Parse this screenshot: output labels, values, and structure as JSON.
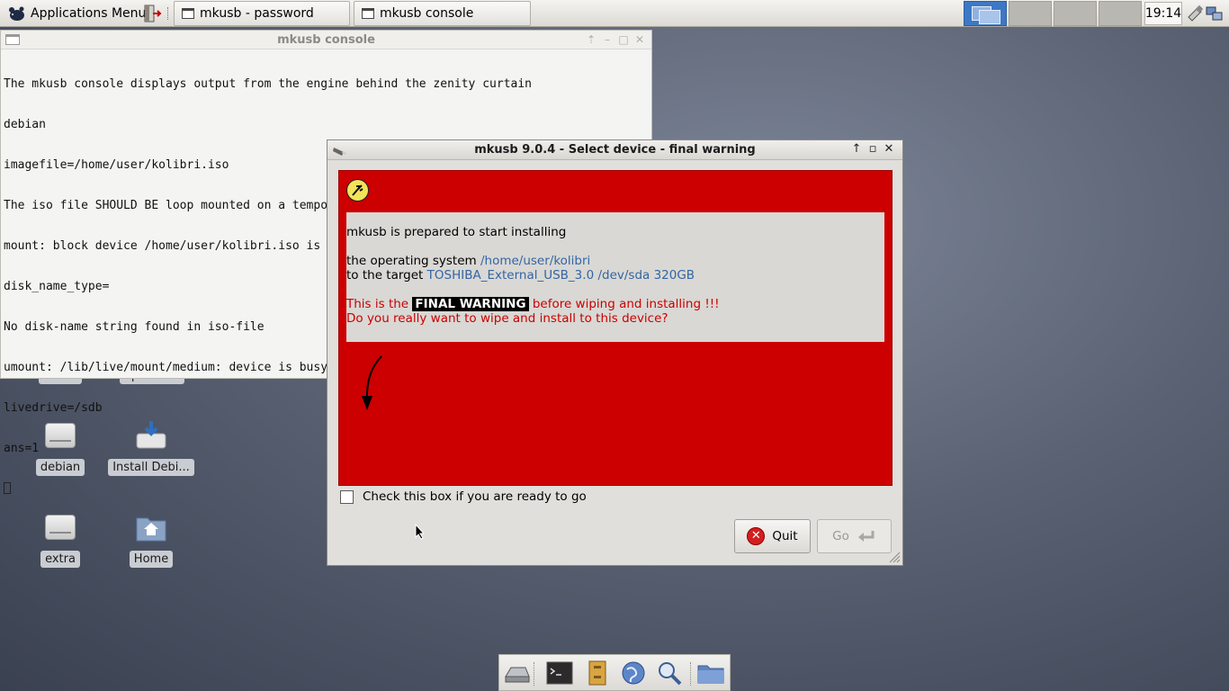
{
  "top_panel": {
    "app_menu_label": "Applications Menu",
    "tasks": [
      {
        "label": "mkusb - password"
      },
      {
        "label": "mkusb console"
      }
    ],
    "clock": "19:14"
  },
  "desktop_icons": [
    {
      "label": "buntu"
    },
    {
      "label": "opensuse"
    },
    {
      "label": "debian"
    },
    {
      "label": "Install Debi..."
    },
    {
      "label": "extra"
    },
    {
      "label": "Home"
    }
  ],
  "console_window": {
    "title": "mkusb console",
    "lines": [
      "The mkusb console displays output from the engine behind the zenity curtain",
      "debian",
      "imagefile=/home/user/kolibri.iso",
      "The iso file SHOULD BE loop mounted on a temporary file READ-ONLY:",
      "mount: block device /home/user/kolibri.iso is write-protected, mounting read-only",
      "disk_name_type=",
      "No disk-name string found in iso-file",
      "umount: /lib/live/mount/medium: device is busy.",
      "livedrive=/sdb",
      "ans=1"
    ]
  },
  "dialog": {
    "title": "mkusb 9.0.4 - Select device - final warning",
    "intro": "mkusb is prepared to start installing",
    "os_prefix": "the operating system ",
    "os_value": "/home/user/kolibri",
    "target_prefix": "to the target ",
    "target_value": "TOSHIBA_External_USB_3.0 /dev/sda 320GB",
    "warn_pre": "This is the ",
    "warn_highlight": "FINAL WARNING",
    "warn_post": " before wiping and installing !!!",
    "question": "Do you really want to wipe and install to this device?",
    "checkbox_label": "Check this box if you are ready to go",
    "checkbox_checked": false,
    "quit_label": "Quit",
    "go_label": "Go",
    "go_enabled": false
  },
  "colors": {
    "warning_bg": "#cc0000",
    "link_blue": "#3465a4",
    "workspace_active": "#3d78c6"
  },
  "icons": {
    "dock": [
      "drive-icon",
      "terminal-icon",
      "file-cabinet-icon",
      "web-browser-icon",
      "search-icon",
      "folder-icon"
    ]
  }
}
